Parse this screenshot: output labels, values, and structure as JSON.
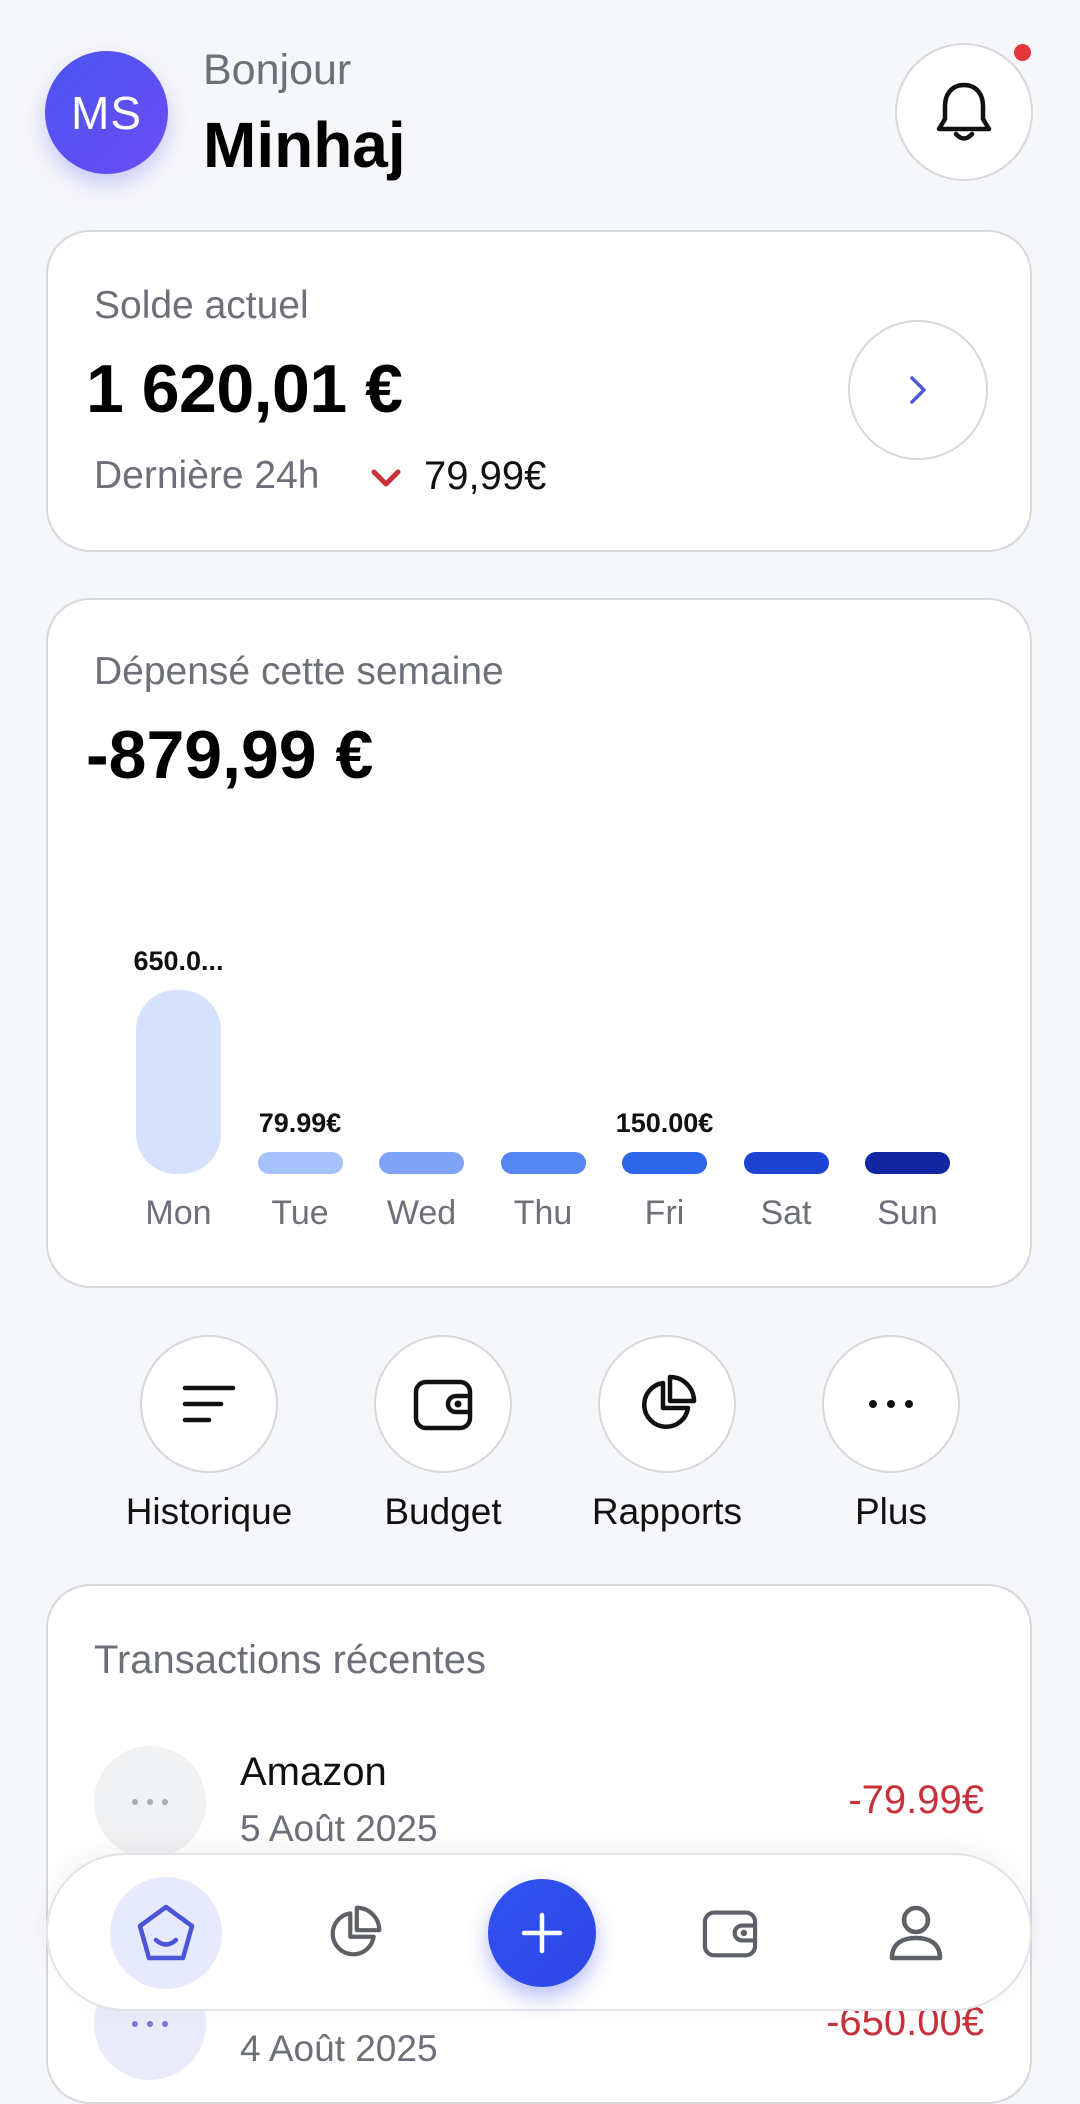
{
  "header": {
    "avatar_initials": "MS",
    "greeting": "Bonjour",
    "name": "Minhaj"
  },
  "balance": {
    "label": "Solde actuel",
    "amount": "1 620,01 €",
    "period_label": "Dernière 24h",
    "change": "79,99€",
    "change_direction": "down"
  },
  "spending": {
    "label": "Dépensé cette semaine",
    "amount": "-879,99 €"
  },
  "chart_data": {
    "type": "bar",
    "categories": [
      "Mon",
      "Tue",
      "Wed",
      "Thu",
      "Fri",
      "Sat",
      "Sun"
    ],
    "values": [
      650.0,
      79.99,
      0,
      0,
      150.0,
      0,
      0
    ],
    "data_labels": [
      "650.0...",
      "79.99€",
      "",
      "",
      "150.00€",
      "",
      ""
    ],
    "bar_colors": [
      "#d6e2fd",
      "#a7c2fb",
      "#7fa3f7",
      "#5587f3",
      "#2c66ea",
      "#1c43d2",
      "#1226a4"
    ]
  },
  "quick_actions": [
    {
      "label": "Historique",
      "icon": "list-icon"
    },
    {
      "label": "Budget",
      "icon": "wallet-icon"
    },
    {
      "label": "Rapports",
      "icon": "pie-chart-icon"
    },
    {
      "label": "Plus",
      "icon": "more-icon"
    }
  ],
  "transactions": {
    "title": "Transactions récentes",
    "items": [
      {
        "name": "Amazon",
        "date": "5 Août 2025",
        "amount": "-79.99€"
      },
      {
        "name": "",
        "date": "4 Août 2025",
        "amount": "-650.00€"
      }
    ]
  },
  "colors": {
    "accent": "#3b55f0",
    "negative": "#c8303a",
    "notification": "#e5373a"
  }
}
